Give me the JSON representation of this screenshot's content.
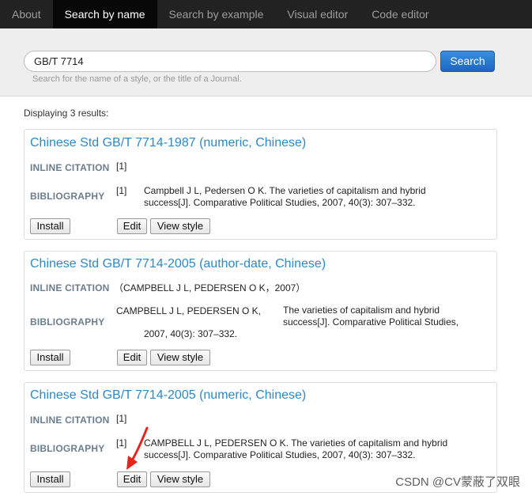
{
  "nav": {
    "items": [
      {
        "label": "About"
      },
      {
        "label": "Search by name"
      },
      {
        "label": "Search by example"
      },
      {
        "label": "Visual editor"
      },
      {
        "label": "Code editor"
      }
    ],
    "active_index": 1
  },
  "search": {
    "value": "GB/T 7714",
    "button_label": "Search",
    "hint": "Search for the name of a style, or the title of a Journal."
  },
  "results_count": "Displaying 3 results:",
  "labels": {
    "inline_citation": "INLINE CITATION",
    "bibliography": "BIBLIOGRAPHY",
    "install": "Install",
    "edit": "Edit",
    "view_style": "View style"
  },
  "results": [
    {
      "title": "Chinese Std GB/T 7714-1987 (numeric, Chinese)",
      "inline": "[1]",
      "bib_number": "[1]",
      "bib_line1": "Campbell J L, Pedersen O K. The varieties of capitalism and hybrid",
      "bib_line2": "success[J]. Comparative Political Studies, 2007, 40(3): 307–332."
    },
    {
      "title": "Chinese Std GB/T 7714-2005 (author-date, Chinese)",
      "inline": "（CAMPBELL J L, PEDERSEN O K，2007）",
      "bib_author": "CAMPBELL J L, PEDERSEN O K,",
      "bib_line1": "The varieties of capitalism and hybrid",
      "bib_line2": "success[J]. Comparative Political Studies,",
      "bib_line3": "2007, 40(3): 307–332."
    },
    {
      "title": "Chinese Std GB/T 7714-2005 (numeric, Chinese)",
      "inline": "[1]",
      "bib_number": "[1]",
      "bib_line1": "CAMPBELL J L, PEDERSEN O K. The varieties of capitalism and hybrid",
      "bib_line2": "success[J]. Comparative Political Studies, 2007, 40(3): 307–332."
    }
  ],
  "watermark": "CSDN @CV蒙蔽了双眼",
  "colors": {
    "nav_bg": "#222222",
    "accent_title": "#2a8ac9",
    "search_button": "#1d66c2",
    "annotation_arrow": "#e8231c"
  }
}
